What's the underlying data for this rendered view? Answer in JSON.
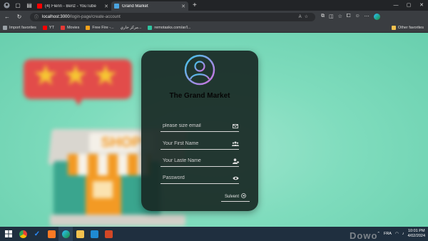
{
  "browser": {
    "tabs": [
      {
        "title": "(4) Flenn - Beriz - YouTube",
        "favicon_color": "#ff0000"
      },
      {
        "title": "Grand Market",
        "favicon_color": "#4aa3df"
      }
    ],
    "active_tab": 1,
    "url_host": "localhost:3000",
    "url_path": "/login-page/create-account",
    "bookmarks": [
      {
        "label": "Import favorites",
        "color": "#9aa0a6"
      },
      {
        "label": "YT",
        "color": "#ff0000"
      },
      {
        "label": "Movies",
        "color": "#e53935"
      },
      {
        "label": "Free Fire -...",
        "color": "#f4a21b"
      },
      {
        "label": "مركز جاري...",
        "color": "#9aa0a6"
      },
      {
        "label": "remotasks.com/ar/l...",
        "color": "#2fc4a0"
      }
    ],
    "other_favorites": "Other favorites"
  },
  "page": {
    "title": "The Grand Market",
    "fields": [
      {
        "placeholder": "please size email",
        "icon": "envelope-icon"
      },
      {
        "placeholder": "Your First Name",
        "icon": "users-icon"
      },
      {
        "placeholder": "Your Laste Name",
        "icon": "user-tag-icon"
      },
      {
        "placeholder": "Password",
        "icon": "eye-icon"
      }
    ],
    "submit_label": "Sulvent",
    "accent_gradient": [
      "#c86ee0",
      "#3ec7e8"
    ]
  },
  "taskbar": {
    "language": "FRA",
    "time": "10:01 PM",
    "date": "4/02/2024"
  }
}
